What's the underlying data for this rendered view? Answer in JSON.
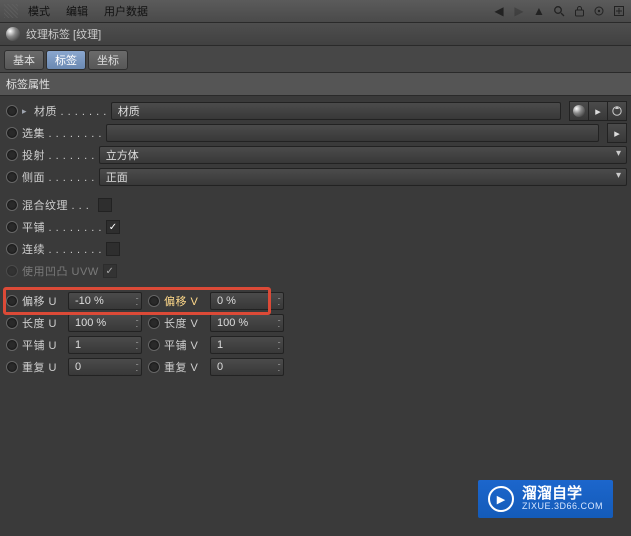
{
  "menubar": {
    "items": [
      "模式",
      "编辑",
      "用户数据"
    ]
  },
  "header": {
    "title": "纹理标签 [纹理]"
  },
  "tabs": [
    "基本",
    "标签",
    "坐标"
  ],
  "active_tab": 1,
  "section": "标签属性",
  "props": {
    "material": {
      "label": "材质 . . . . . . .",
      "value": "材质"
    },
    "selection": {
      "label": "选集 . . . . . . . ."
    },
    "projection": {
      "label": "投射 . . . . . . .",
      "value": "立方体"
    },
    "side": {
      "label": "侧面 . . . . . . .",
      "value": "正面"
    },
    "mix": {
      "label": "混合纹理 . . .",
      "checked": false
    },
    "tile": {
      "label": "平铺 . . . . . . . .",
      "checked": true
    },
    "seamless": {
      "label": "连续 . . . . . . . .",
      "checked": false
    },
    "useuvw": {
      "label": "使用凹凸 UVW",
      "checked": true
    }
  },
  "uv": {
    "offset_u": {
      "label": "偏移 U",
      "value": "-10 %"
    },
    "offset_v": {
      "label": "偏移 V",
      "value": "0 %"
    },
    "length_u": {
      "label": "长度 U",
      "value": "100 %"
    },
    "length_v": {
      "label": "长度 V",
      "value": "100 %"
    },
    "tile_u": {
      "label": "平铺 U",
      "value": "1"
    },
    "tile_v": {
      "label": "平铺 V",
      "value": "1"
    },
    "rep_u": {
      "label": "重复 U",
      "value": "0"
    },
    "rep_v": {
      "label": "重复 V",
      "value": "0"
    }
  },
  "watermark": {
    "big": "溜溜自学",
    "small": "ZIXUE.3D66.COM"
  }
}
